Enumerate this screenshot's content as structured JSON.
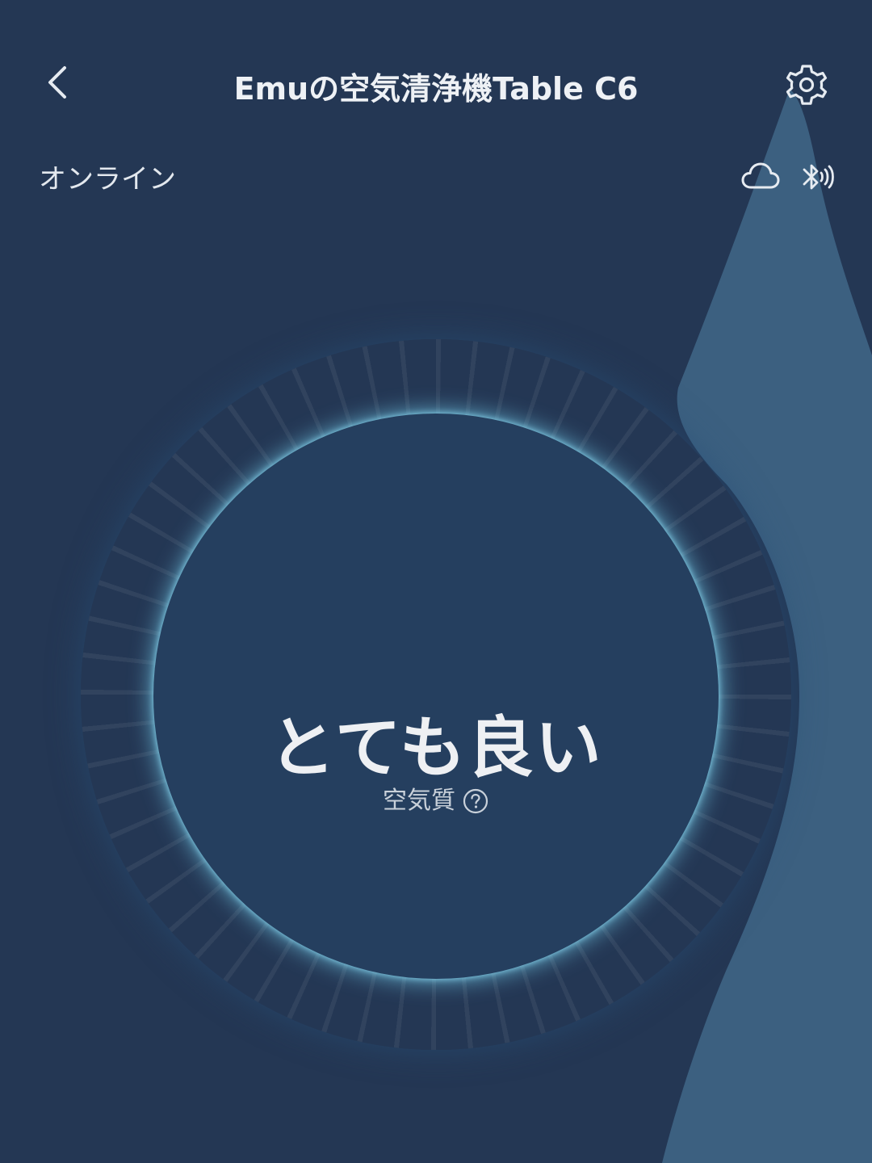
{
  "header": {
    "title": "Emuの空気清浄機Table C6",
    "back_icon": "chevron-left-icon",
    "settings_icon": "gear-icon"
  },
  "status": {
    "connection_label": "オンライン",
    "cloud_icon": "cloud-icon",
    "bluetooth_icon": "bluetooth-icon"
  },
  "air_quality": {
    "value": "とても良い",
    "label": "空気質",
    "help_icon": "question-circle-icon"
  },
  "colors": {
    "background": "#243754",
    "wave": "#3c6080",
    "ring_glow": "#7fd2ea",
    "text": "#eef1f5"
  }
}
